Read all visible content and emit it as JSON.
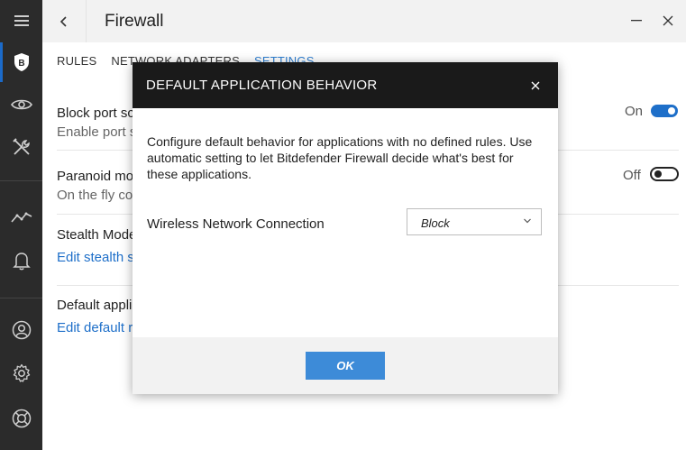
{
  "window": {
    "title": "Firewall"
  },
  "sidebar": {
    "items": [
      {
        "icon": "menu-icon"
      },
      {
        "icon": "bitdefender-shield-icon",
        "label": "B"
      },
      {
        "icon": "eye-icon"
      },
      {
        "icon": "tools-icon"
      },
      {
        "icon": "activity-graph-icon"
      },
      {
        "icon": "bell-icon"
      },
      {
        "icon": "account-icon"
      },
      {
        "icon": "gear-icon"
      },
      {
        "icon": "lifebuoy-icon"
      }
    ],
    "active_color": "#1b6ac9"
  },
  "tabs": [
    {
      "label": "RULES",
      "active": false
    },
    {
      "label": "NETWORK ADAPTERS",
      "active": false
    },
    {
      "label": "SETTINGS",
      "active": true
    }
  ],
  "settings": [
    {
      "title": "Block port scans",
      "subtitle": "Enable port scan",
      "toggle_label": "On",
      "toggle_state": "on"
    },
    {
      "title": "Paranoid mode",
      "subtitle": "On the fly control",
      "toggle_label": "Off",
      "toggle_state": "off"
    },
    {
      "title": "Stealth Mode",
      "link": "Edit stealth settings"
    },
    {
      "title": "Default application behavior",
      "link": "Edit default rules"
    }
  ],
  "dialog": {
    "title": "DEFAULT APPLICATION BEHAVIOR",
    "description": "Configure default behavior for applications with no defined rules. Use automatic setting to let Bitdefender Firewall decide what's best for these applications.",
    "field_label": "Wireless Network Connection",
    "select_value": "Block",
    "ok_label": "OK"
  },
  "colors": {
    "accent": "#1e6fc9",
    "sidebar_bg": "#2b2b2b",
    "dialog_header_bg": "#1a1a1a",
    "ok_button": "#3d8bd8"
  }
}
